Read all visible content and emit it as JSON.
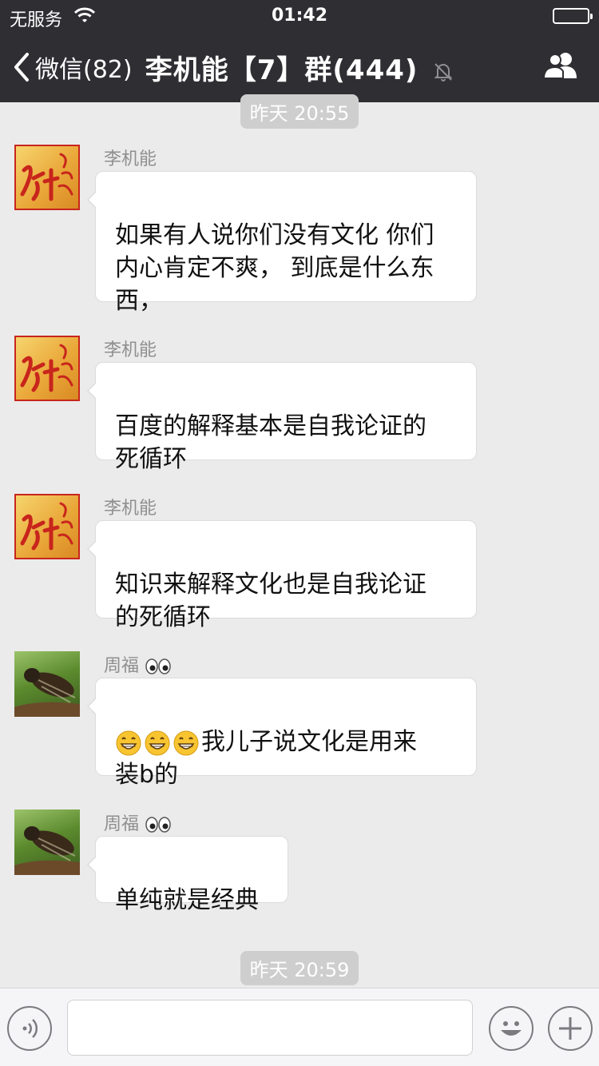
{
  "status_bar": {
    "carrier": "无服务",
    "time": "01:42",
    "battery_level": 1.0
  },
  "nav": {
    "back_label": "微信(82)",
    "title": "李机能【7】群(444)"
  },
  "timestamps": [
    "昨天 20:55",
    "昨天 20:59"
  ],
  "messages": [
    {
      "sender": "李机能",
      "avatar": "red-calligraphy-avatar",
      "text": "如果有人说你们没有文化 你们\n内心肯定不爽， 到底是什么东\n西，"
    },
    {
      "sender": "李机能",
      "avatar": "red-calligraphy-avatar",
      "text": "百度的解释基本是自我论证的\n死循环"
    },
    {
      "sender": "李机能",
      "avatar": "red-calligraphy-avatar",
      "text": "知识来解释文化也是自我论证\n的死循环"
    },
    {
      "sender": "周福",
      "avatar": "cicada-photo-avatar",
      "sender_emoji": "eyes-emoji",
      "text_emoji": "grin-emoji",
      "emoji_count": 3,
      "text": "我儿子说文化是用来\n装b的"
    },
    {
      "sender": "周福",
      "avatar": "cicada-photo-avatar",
      "sender_emoji": "eyes-emoji",
      "text": "单纯就是经典"
    }
  ],
  "input_bar": {
    "voice_icon": "voice-icon",
    "emoji_icon": "emoji-icon",
    "plus_icon": "plus-icon",
    "input_value": ""
  },
  "colors": {
    "nav_bg": "#2e2e33",
    "chat_bg": "#ebebeb",
    "bubble_bg": "#ffffff",
    "timestamp_bg": "#cecece",
    "sender_text": "#8f8f8f"
  }
}
